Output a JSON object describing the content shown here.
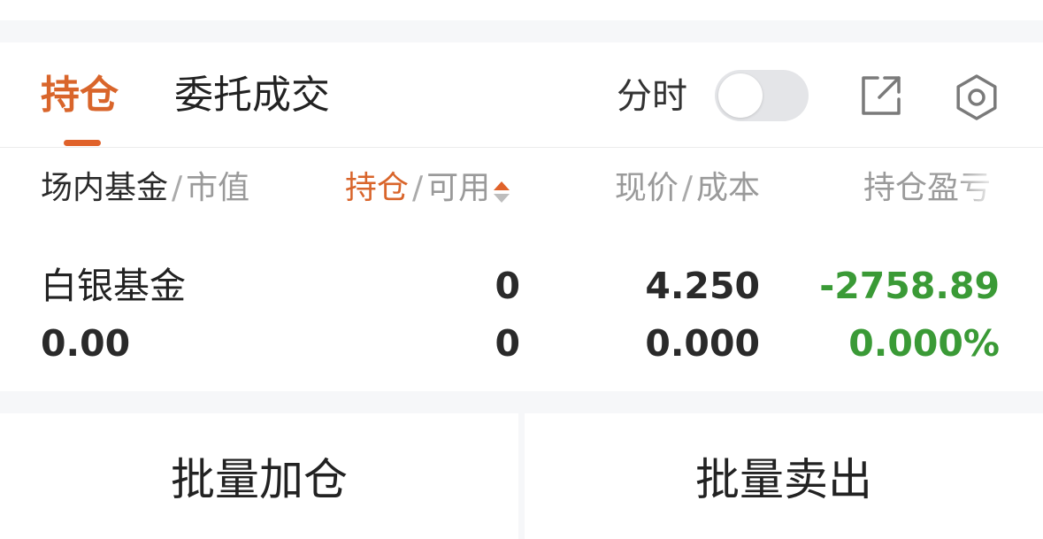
{
  "tabs": {
    "positions": "持仓",
    "orders": "委托成交"
  },
  "timeshare": {
    "label": "分时",
    "enabled": false
  },
  "icons": {
    "share": "external-link-icon",
    "settings": "gear-icon",
    "sort": "sort-updown-icon"
  },
  "columns": {
    "name": "场内基金",
    "market_value": "市值",
    "holding": "持仓",
    "available": "可用",
    "price": "现价",
    "cost": "成本",
    "pnl": "持仓盈亏"
  },
  "position": {
    "name": "白银基金",
    "market_value": "0.00",
    "holding": "0",
    "available": "0",
    "price": "4.250",
    "cost": "0.000",
    "pnl": "-2758.89",
    "pnl_pct": "0.000%"
  },
  "actions": {
    "batch_add": "批量加仓",
    "batch_sell": "批量卖出"
  },
  "colors": {
    "accent": "#e0622a",
    "profit_green": "#3a9a36"
  }
}
